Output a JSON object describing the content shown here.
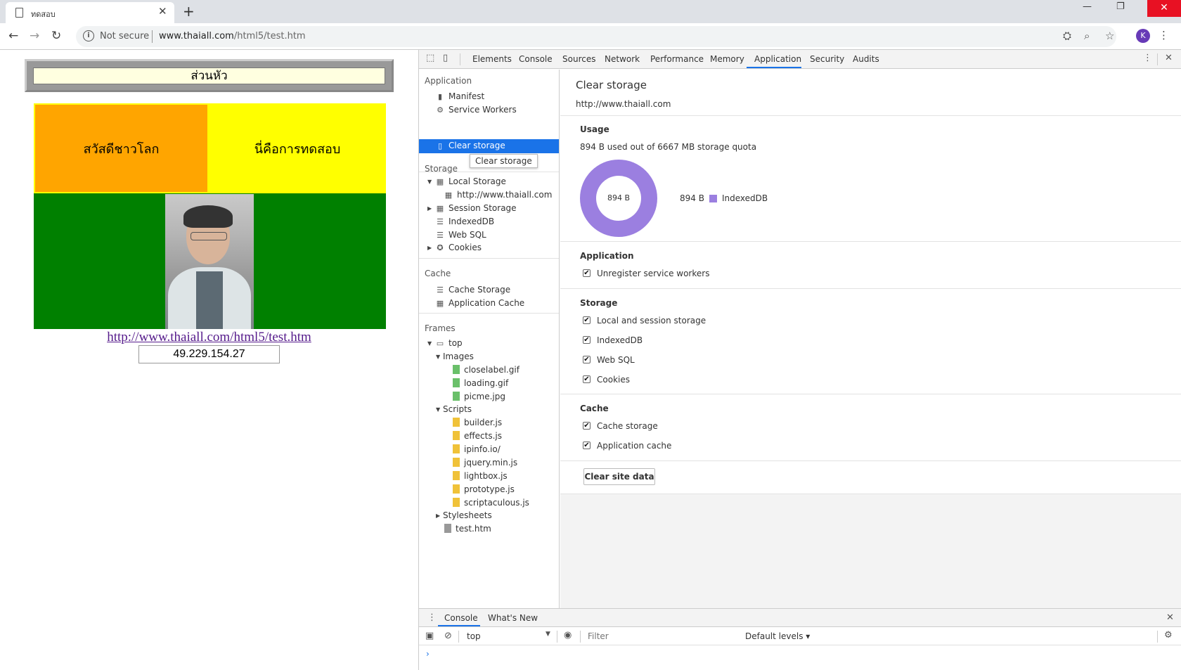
{
  "browser": {
    "tab_title": "ทดสอบ",
    "tab_close": "✕",
    "new_tab": "+",
    "not_secure": "Not secure",
    "url_host": "www.thaiall.com",
    "url_path": "/html5/test.htm",
    "avatar_letter": "K",
    "win_minimize": "—",
    "win_restore": "❐",
    "win_close": "✕"
  },
  "page": {
    "header": "ส่วนหัว",
    "cell_left": "สวัสดีชาวโลก",
    "cell_right": "นี่คือการทดสอบ",
    "link": "http://www.thaiall.com/html5/test.htm",
    "ip": "49.229.154.27",
    "colors": {
      "orange": "#ffa500",
      "yellow": "#ffff00",
      "green": "#008000",
      "header_bg": "#ffffe0"
    }
  },
  "devtools": {
    "tabs": [
      "Elements",
      "Console",
      "Sources",
      "Network",
      "Performance",
      "Memory",
      "Application",
      "Security",
      "Audits"
    ],
    "active_tab": "Application",
    "sidebar": {
      "application_section": "Application",
      "manifest": "Manifest",
      "service_workers": "Service Workers",
      "clear_storage": "Clear storage",
      "tooltip": "Clear storage",
      "storage_section": "Storage",
      "local_storage": "Local Storage",
      "local_storage_origin": "http://www.thaiall.com",
      "session_storage": "Session Storage",
      "indexeddb": "IndexedDB",
      "web_sql": "Web SQL",
      "cookies": "Cookies",
      "cache_section": "Cache",
      "cache_storage": "Cache Storage",
      "application_cache": "Application Cache",
      "frames_section": "Frames",
      "frame_top": "top",
      "images_folder": "Images",
      "images": [
        "closelabel.gif",
        "loading.gif",
        "picme.jpg"
      ],
      "scripts_folder": "Scripts",
      "scripts": [
        "builder.js",
        "effects.js",
        "ipinfo.io/",
        "jquery.min.js",
        "lightbox.js",
        "prototype.js",
        "scriptaculous.js"
      ],
      "stylesheets_folder": "Stylesheets",
      "document": "test.htm"
    },
    "main": {
      "title": "Clear storage",
      "origin": "http://www.thaiall.com",
      "usage_heading": "Usage",
      "usage_text": "894 B used out of 6667 MB storage quota",
      "donut_label": "894 B",
      "legend_value": "894 B",
      "legend_name": "IndexedDB",
      "legend_color": "#9b7fe0",
      "application_heading": "Application",
      "unregister_sw": "Unregister service workers",
      "storage_heading": "Storage",
      "storage_options": [
        "Local and session storage",
        "IndexedDB",
        "Web SQL",
        "Cookies"
      ],
      "cache_heading": "Cache",
      "cache_options": [
        "Cache storage",
        "Application cache"
      ],
      "clear_button": "Clear site data"
    },
    "drawer": {
      "tab_console": "Console",
      "tab_whats_new": "What's New",
      "context": "top",
      "filter_placeholder": "Filter",
      "levels": "Default levels ▾",
      "prompt": "›"
    }
  }
}
